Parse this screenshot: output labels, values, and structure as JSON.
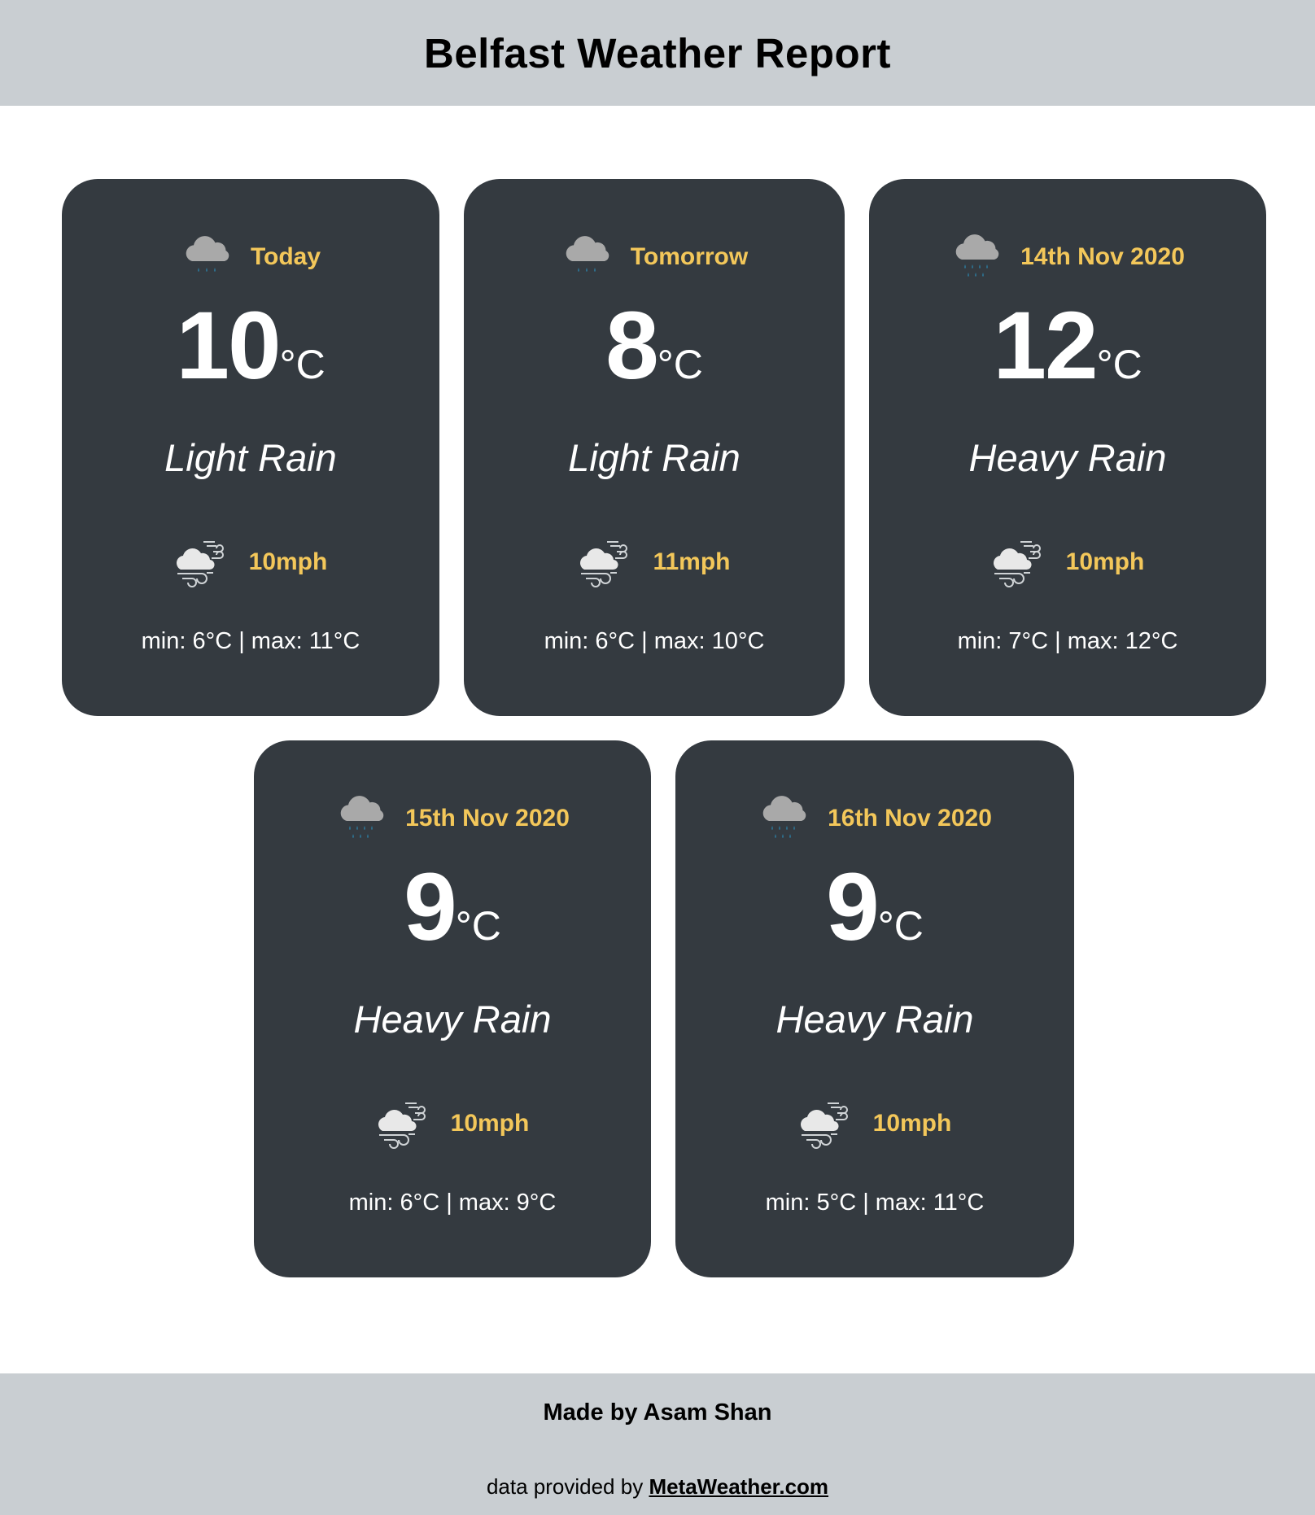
{
  "header": {
    "title": "Belfast Weather Report"
  },
  "temp_unit": "°C",
  "cards": [
    {
      "day": "Today",
      "temp": "10",
      "condition": "Light Rain",
      "wind": "10mph",
      "minmax": "min: 6°C | max: 11°C",
      "weather_icon": "light-rain-icon",
      "wind_icon": "wind-icon"
    },
    {
      "day": "Tomorrow",
      "temp": "8",
      "condition": "Light Rain",
      "wind": "11mph",
      "minmax": "min: 6°C | max: 10°C",
      "weather_icon": "light-rain-icon",
      "wind_icon": "wind-icon"
    },
    {
      "day": "14th Nov 2020",
      "temp": "12",
      "condition": "Heavy Rain",
      "wind": "10mph",
      "minmax": "min: 7°C | max: 12°C",
      "weather_icon": "heavy-rain-icon",
      "wind_icon": "wind-icon"
    },
    {
      "day": "15th Nov 2020",
      "temp": "9",
      "condition": "Heavy Rain",
      "wind": "10mph",
      "minmax": "min: 6°C | max: 9°C",
      "weather_icon": "heavy-rain-icon",
      "wind_icon": "wind-icon"
    },
    {
      "day": "16th Nov 2020",
      "temp": "9",
      "condition": "Heavy Rain",
      "wind": "10mph",
      "minmax": "min: 5°C | max: 11°C",
      "weather_icon": "heavy-rain-icon",
      "wind_icon": "wind-icon"
    }
  ],
  "footer": {
    "made_by": "Made by Asam Shan",
    "provided_prefix": "data provided by",
    "provider_link": "MetaWeather.com"
  },
  "colors": {
    "header_bg": "#c9ced2",
    "card_bg": "#343a40",
    "accent": "#f3c75a",
    "rain_drop": "#2e6e8c"
  }
}
